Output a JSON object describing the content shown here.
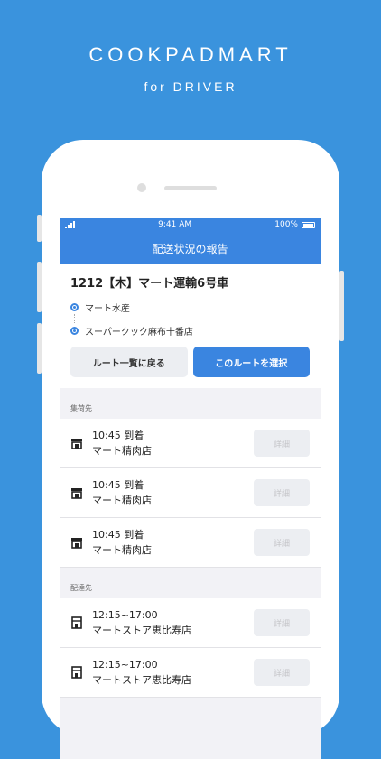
{
  "hero": {
    "title": "COOKPADMART",
    "subtitle": "for DRIVER"
  },
  "status_bar": {
    "time": "9:41 AM",
    "battery": "100%"
  },
  "nav": {
    "title": "配送状況の報告"
  },
  "route": {
    "title": "1212【木】マート運輸6号車",
    "stops": [
      "マート水産",
      "スーパークック麻布十番店"
    ],
    "back_button": "ルート一覧に戻る",
    "select_button": "このルートを選択"
  },
  "pickup": {
    "header": "集荷先",
    "items": [
      {
        "time": "10:45 到着",
        "name": "マート精肉店",
        "detail": "詳細",
        "icon": "shop-icon"
      },
      {
        "time": "10:45 到着",
        "name": "マート精肉店",
        "detail": "詳細",
        "icon": "shop-icon"
      },
      {
        "time": "10:45 到着",
        "name": "マート精肉店",
        "detail": "詳細",
        "icon": "shop-icon"
      }
    ]
  },
  "delivery": {
    "header": "配達先",
    "items": [
      {
        "time": "12:15~17:00",
        "name": "マートストア恵比寿店",
        "detail": "詳細",
        "icon": "store-icon"
      },
      {
        "time": "12:15~17:00",
        "name": "マートストア恵比寿店",
        "detail": "詳細",
        "icon": "store-icon"
      }
    ]
  },
  "colors": {
    "background": "#3a93dd",
    "primary": "#3a85e0"
  }
}
